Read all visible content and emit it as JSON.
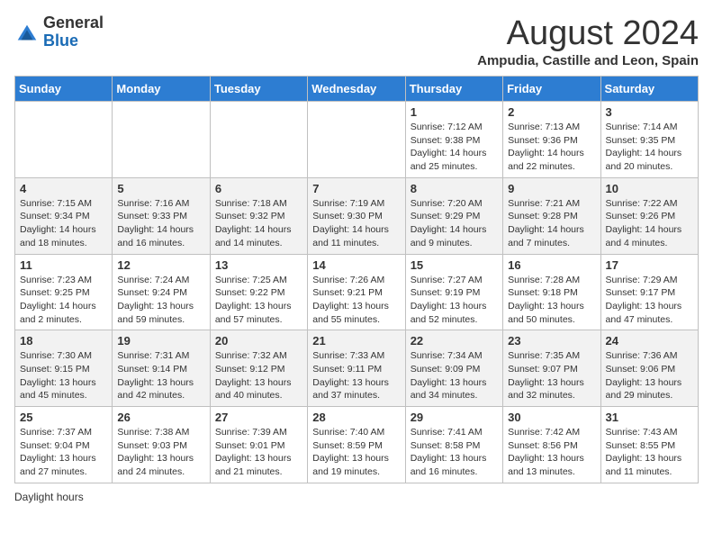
{
  "header": {
    "logo_general": "General",
    "logo_blue": "Blue",
    "main_title": "August 2024",
    "subtitle": "Ampudia, Castille and Leon, Spain"
  },
  "days_of_week": [
    "Sunday",
    "Monday",
    "Tuesday",
    "Wednesday",
    "Thursday",
    "Friday",
    "Saturday"
  ],
  "weeks": [
    [
      {
        "day": "",
        "info": ""
      },
      {
        "day": "",
        "info": ""
      },
      {
        "day": "",
        "info": ""
      },
      {
        "day": "",
        "info": ""
      },
      {
        "day": "1",
        "info": "Sunrise: 7:12 AM\nSunset: 9:38 PM\nDaylight: 14 hours\nand 25 minutes."
      },
      {
        "day": "2",
        "info": "Sunrise: 7:13 AM\nSunset: 9:36 PM\nDaylight: 14 hours\nand 22 minutes."
      },
      {
        "day": "3",
        "info": "Sunrise: 7:14 AM\nSunset: 9:35 PM\nDaylight: 14 hours\nand 20 minutes."
      }
    ],
    [
      {
        "day": "4",
        "info": "Sunrise: 7:15 AM\nSunset: 9:34 PM\nDaylight: 14 hours\nand 18 minutes."
      },
      {
        "day": "5",
        "info": "Sunrise: 7:16 AM\nSunset: 9:33 PM\nDaylight: 14 hours\nand 16 minutes."
      },
      {
        "day": "6",
        "info": "Sunrise: 7:18 AM\nSunset: 9:32 PM\nDaylight: 14 hours\nand 14 minutes."
      },
      {
        "day": "7",
        "info": "Sunrise: 7:19 AM\nSunset: 9:30 PM\nDaylight: 14 hours\nand 11 minutes."
      },
      {
        "day": "8",
        "info": "Sunrise: 7:20 AM\nSunset: 9:29 PM\nDaylight: 14 hours\nand 9 minutes."
      },
      {
        "day": "9",
        "info": "Sunrise: 7:21 AM\nSunset: 9:28 PM\nDaylight: 14 hours\nand 7 minutes."
      },
      {
        "day": "10",
        "info": "Sunrise: 7:22 AM\nSunset: 9:26 PM\nDaylight: 14 hours\nand 4 minutes."
      }
    ],
    [
      {
        "day": "11",
        "info": "Sunrise: 7:23 AM\nSunset: 9:25 PM\nDaylight: 14 hours\nand 2 minutes."
      },
      {
        "day": "12",
        "info": "Sunrise: 7:24 AM\nSunset: 9:24 PM\nDaylight: 13 hours\nand 59 minutes."
      },
      {
        "day": "13",
        "info": "Sunrise: 7:25 AM\nSunset: 9:22 PM\nDaylight: 13 hours\nand 57 minutes."
      },
      {
        "day": "14",
        "info": "Sunrise: 7:26 AM\nSunset: 9:21 PM\nDaylight: 13 hours\nand 55 minutes."
      },
      {
        "day": "15",
        "info": "Sunrise: 7:27 AM\nSunset: 9:19 PM\nDaylight: 13 hours\nand 52 minutes."
      },
      {
        "day": "16",
        "info": "Sunrise: 7:28 AM\nSunset: 9:18 PM\nDaylight: 13 hours\nand 50 minutes."
      },
      {
        "day": "17",
        "info": "Sunrise: 7:29 AM\nSunset: 9:17 PM\nDaylight: 13 hours\nand 47 minutes."
      }
    ],
    [
      {
        "day": "18",
        "info": "Sunrise: 7:30 AM\nSunset: 9:15 PM\nDaylight: 13 hours\nand 45 minutes."
      },
      {
        "day": "19",
        "info": "Sunrise: 7:31 AM\nSunset: 9:14 PM\nDaylight: 13 hours\nand 42 minutes."
      },
      {
        "day": "20",
        "info": "Sunrise: 7:32 AM\nSunset: 9:12 PM\nDaylight: 13 hours\nand 40 minutes."
      },
      {
        "day": "21",
        "info": "Sunrise: 7:33 AM\nSunset: 9:11 PM\nDaylight: 13 hours\nand 37 minutes."
      },
      {
        "day": "22",
        "info": "Sunrise: 7:34 AM\nSunset: 9:09 PM\nDaylight: 13 hours\nand 34 minutes."
      },
      {
        "day": "23",
        "info": "Sunrise: 7:35 AM\nSunset: 9:07 PM\nDaylight: 13 hours\nand 32 minutes."
      },
      {
        "day": "24",
        "info": "Sunrise: 7:36 AM\nSunset: 9:06 PM\nDaylight: 13 hours\nand 29 minutes."
      }
    ],
    [
      {
        "day": "25",
        "info": "Sunrise: 7:37 AM\nSunset: 9:04 PM\nDaylight: 13 hours\nand 27 minutes."
      },
      {
        "day": "26",
        "info": "Sunrise: 7:38 AM\nSunset: 9:03 PM\nDaylight: 13 hours\nand 24 minutes."
      },
      {
        "day": "27",
        "info": "Sunrise: 7:39 AM\nSunset: 9:01 PM\nDaylight: 13 hours\nand 21 minutes."
      },
      {
        "day": "28",
        "info": "Sunrise: 7:40 AM\nSunset: 8:59 PM\nDaylight: 13 hours\nand 19 minutes."
      },
      {
        "day": "29",
        "info": "Sunrise: 7:41 AM\nSunset: 8:58 PM\nDaylight: 13 hours\nand 16 minutes."
      },
      {
        "day": "30",
        "info": "Sunrise: 7:42 AM\nSunset: 8:56 PM\nDaylight: 13 hours\nand 13 minutes."
      },
      {
        "day": "31",
        "info": "Sunrise: 7:43 AM\nSunset: 8:55 PM\nDaylight: 13 hours\nand 11 minutes."
      }
    ]
  ],
  "footer": {
    "daylight_label": "Daylight hours"
  }
}
